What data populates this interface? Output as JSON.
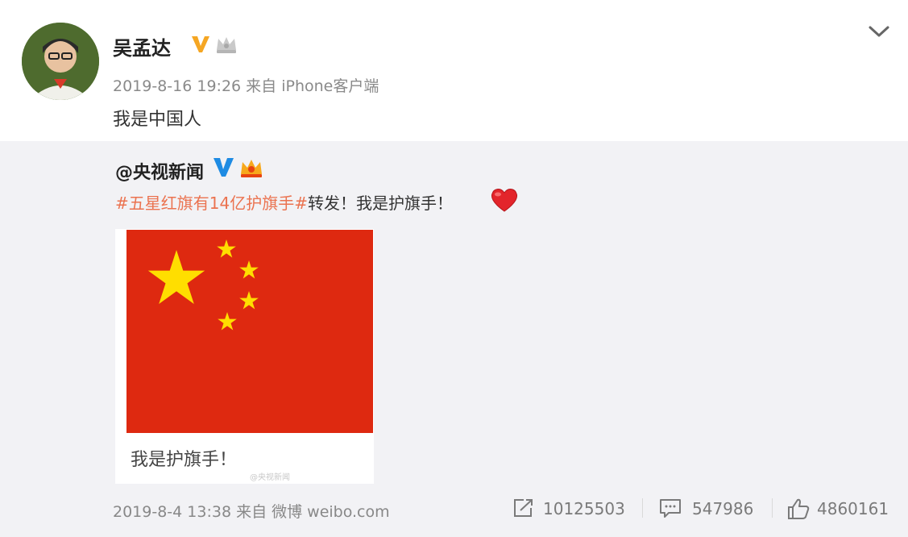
{
  "post": {
    "author": "吴孟达",
    "meta": "2019-8-16 19:26 来自 iPhone客户端",
    "text": "我是中国人",
    "icons": {
      "badge": "verified-v-icon",
      "crown": "member-crown-icon",
      "menu": "chevron-down-icon"
    },
    "colors": {
      "verified": "#f5a623"
    }
  },
  "repost": {
    "user": "@央视新闻",
    "topic": "#五星红旗有14亿护旗手#",
    "text": "转发！我是护旗手！",
    "icons": {
      "badge": "verified-v-icon",
      "crown": "member-crown-icon",
      "emoji": "heart-icon"
    },
    "card": {
      "title": "我是护旗手！",
      "watermark": "@央视新闻",
      "image": "china-flag"
    },
    "footer": {
      "meta": "2019-8-4 13:38 来自 微博 weibo.com",
      "repost_count": "10125503",
      "comment_count": "547986",
      "like_count": "4860161"
    },
    "colors": {
      "verified": "#1e8be3",
      "topic": "#eb7350",
      "flag_red": "#de2910",
      "flag_yellow": "#ffde00"
    }
  }
}
